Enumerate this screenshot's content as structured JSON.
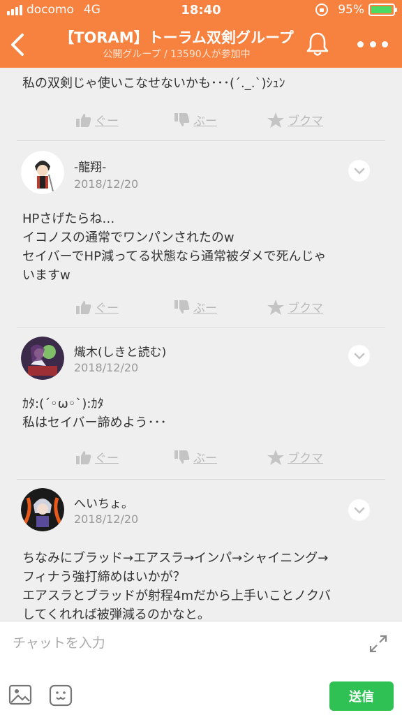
{
  "status_bar": {
    "carrier": "docomo",
    "network": "4G",
    "time": "18:40",
    "battery": "95%",
    "battery_level": 0.95
  },
  "header": {
    "title": "【TORAM】トーラム双剣グループ",
    "subtitle": "公開グループ / 13590人が参加中"
  },
  "actions": {
    "good": "ぐー",
    "boo": "ぶー",
    "bookmark": "ブクマ"
  },
  "partial_post": {
    "text": "私の双剣じゃ使いこなせないかも･･･(´._.`)ｼｭﾝ"
  },
  "posts": [
    {
      "username": "-龍翔-",
      "date": "2018/12/20",
      "lines": [
        "HPさげたらね…",
        "イコノスの通常でワンパンされたのw",
        "セイバーでHP減ってる状態なら通常被ダメで死んじゃ",
        "いますw"
      ]
    },
    {
      "username": "熾木(しきと読む)",
      "date": "2018/12/20",
      "lines": [
        "ｶﾀ:(´◦ω◦`):ｶﾀ",
        "私はセイバー諦めよう･･･"
      ]
    },
    {
      "username": "へいちょ。",
      "date": "2018/12/20",
      "lines": [
        "ちなみにブラッド→エアスラ→インパ→シャイニング→",
        "フィナう強打締めはいかが？",
        "エアスラとブラッドが射程4mだから上手いことノクバ",
        "してくれれば被弾減るのかなと。"
      ]
    }
  ],
  "composer": {
    "placeholder": "チャットを入力",
    "send_label": "送信"
  },
  "colors": {
    "header": "#f7813f",
    "send": "#2fc153",
    "background": "#efefef"
  }
}
